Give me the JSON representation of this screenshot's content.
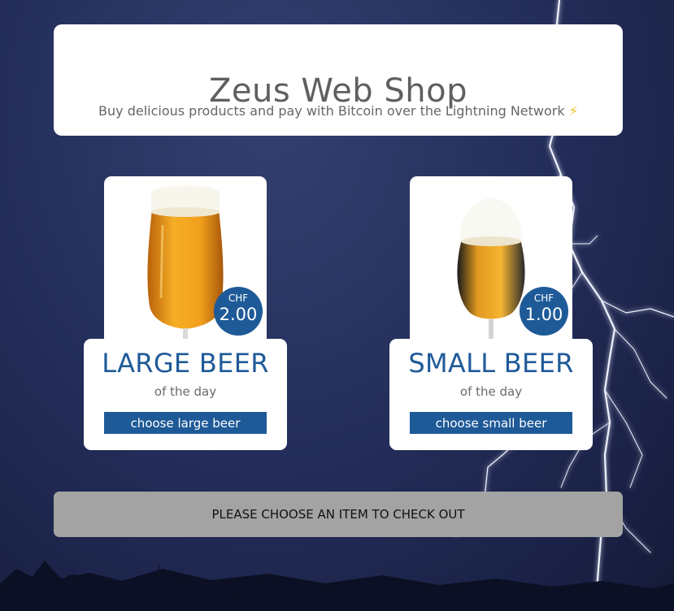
{
  "header": {
    "title": "Zeus Web Shop",
    "subtitle": "Buy delicious products and pay with Bitcoin over the Lightning Network",
    "subtitle_emoji": "⚡"
  },
  "products": [
    {
      "name": "LARGE BEER",
      "subtitle": "of the day",
      "button_label": "choose large beer",
      "currency": "CHF",
      "price": "2.00"
    },
    {
      "name": "SMALL BEER",
      "subtitle": "of the day",
      "button_label": "choose small beer",
      "currency": "CHF",
      "price": "1.00"
    }
  ],
  "checkout": {
    "label": "PLEASE CHOOSE AN ITEM TO CHECK OUT"
  },
  "colors": {
    "accent": "#1f5a98",
    "checkout_disabled": "#a3a3a3",
    "beer": "#f0a21a",
    "lightning": "#e6ecff"
  }
}
